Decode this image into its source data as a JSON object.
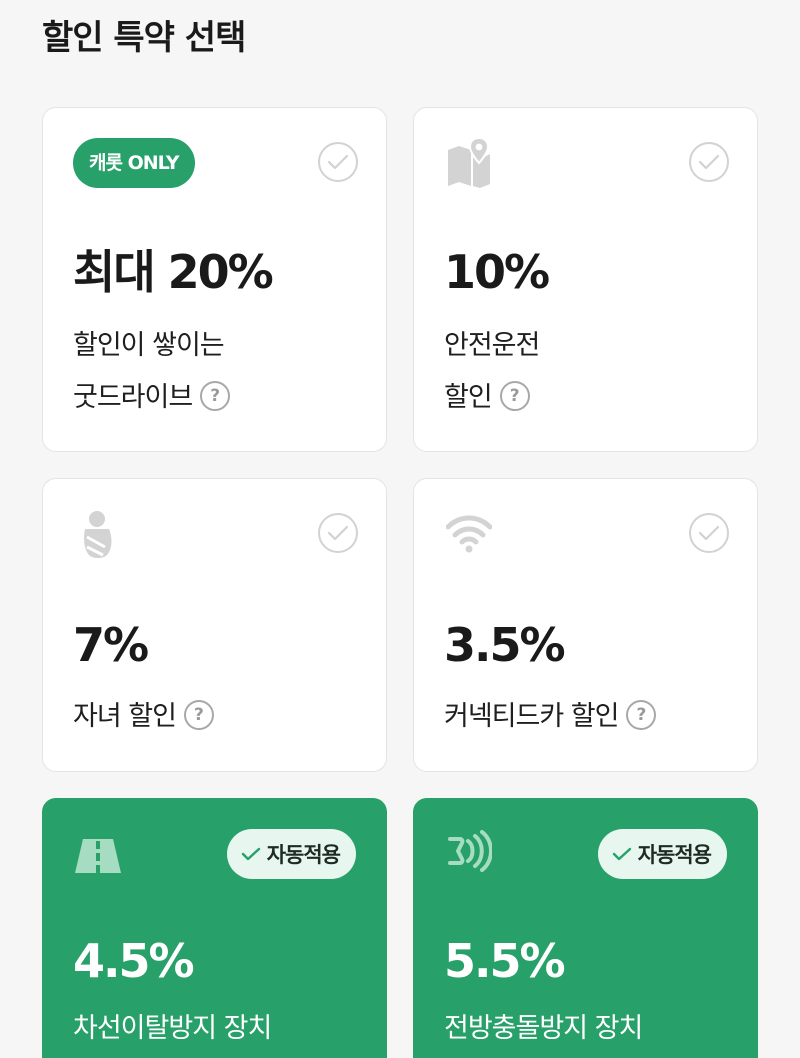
{
  "page": {
    "title": "할인 특약 선택"
  },
  "cards": [
    {
      "badge": "캐롯 ONLY",
      "icon": null,
      "percent": "최대 20%",
      "desc_lines": [
        "할인이 쌓이는",
        "굿드라이브"
      ],
      "has_help": true,
      "help_glyph": "?"
    },
    {
      "badge": null,
      "icon": "map-pin-icon",
      "percent": "10%",
      "desc_lines": [
        "안전운전",
        "할인"
      ],
      "has_help": true,
      "help_glyph": "?"
    },
    {
      "badge": null,
      "icon": "baby-icon",
      "percent": "7%",
      "desc_lines": [
        "자녀 할인"
      ],
      "has_help": true,
      "help_glyph": "?"
    },
    {
      "badge": null,
      "icon": "wifi-icon",
      "percent": "3.5%",
      "desc_lines": [
        "커넥티드카 할인"
      ],
      "has_help": true,
      "help_glyph": "?"
    },
    {
      "auto_badge": "자동적용",
      "icon": "road-icon",
      "percent": "4.5%",
      "desc_lines": [
        "차선이탈방지 장치"
      ]
    },
    {
      "auto_badge": "자동적용",
      "icon": "sensor-icon",
      "percent": "5.5%",
      "desc_lines": [
        "전방충돌방지 장치"
      ]
    }
  ],
  "colors": {
    "accent": "#27a06a",
    "auto_badge_bg": "#e7f6ee",
    "check_border": "#d2d2d2",
    "help_grey": "#a8a8a8"
  }
}
